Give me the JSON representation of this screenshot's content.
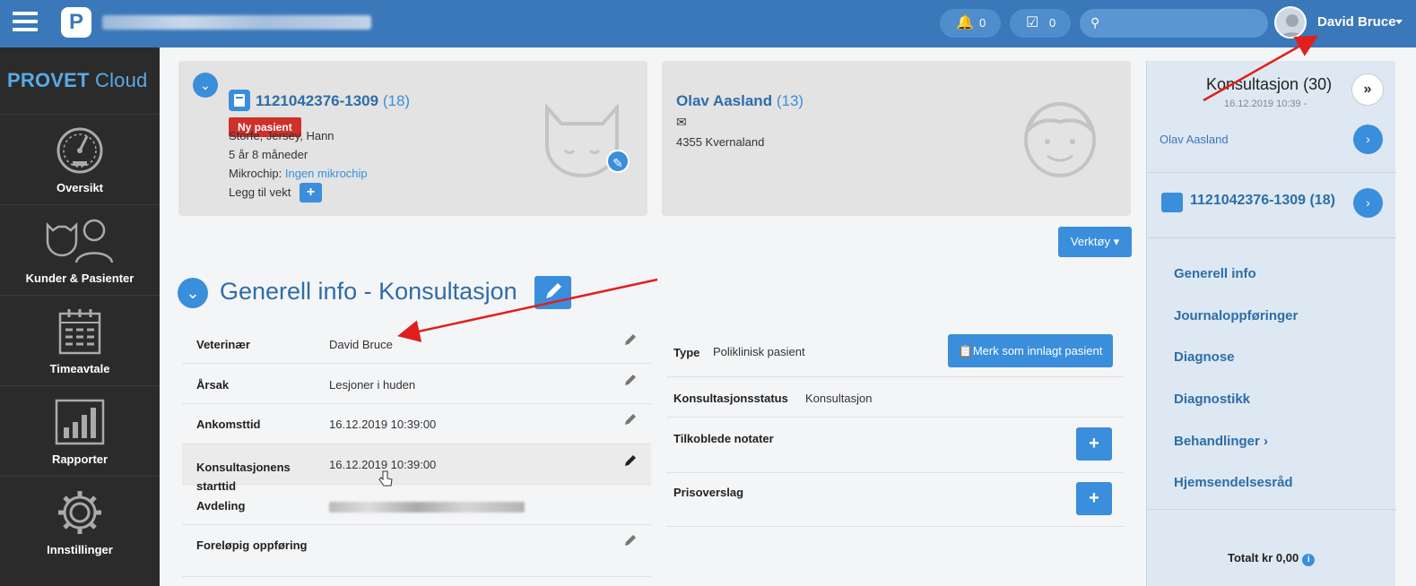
{
  "topbar": {
    "notifications_count": "0",
    "tasks_count": "0",
    "search_placeholder": "",
    "user_name": "David Bruce"
  },
  "sidebar": {
    "brand_part1": "PROVET",
    "brand_part2": "Cloud",
    "items": [
      {
        "label": "Oversikt",
        "icon": "dashboard-gauge-icon"
      },
      {
        "label": "Kunder & Pasienter",
        "icon": "customers-patients-icon"
      },
      {
        "label": "Timeavtale",
        "icon": "calendar-icon"
      },
      {
        "label": "Rapporter",
        "icon": "bar-chart-icon"
      },
      {
        "label": "Innstillinger",
        "icon": "gear-icon"
      }
    ]
  },
  "patient": {
    "id": "1121042376-1309",
    "count": "(18)",
    "badge": "Ny pasient",
    "species": "Storfe, Jersey, Hann",
    "age": "5 år 8 måneder",
    "microchip_label": "Mikrochip:",
    "microchip_value": "Ingen mikrochip",
    "add_weight": "Legg til vekt"
  },
  "owner": {
    "name": "Olav Aasland",
    "count": "(13)",
    "address": "4355 Kvernaland"
  },
  "tools_button": "Verktøy",
  "section": {
    "title": "Generell info - Konsultasjon"
  },
  "left_rows": [
    {
      "label": "Veterinær",
      "value": "David Bruce"
    },
    {
      "label": "Årsak",
      "value": "Lesjoner i huden"
    },
    {
      "label": "Ankomsttid",
      "value": "16.12.2019 10:39:00"
    },
    {
      "label": "Konsultasjonens starttid",
      "value": "16.12.2019 10:39:00"
    },
    {
      "label": "Avdeling",
      "value": ""
    },
    {
      "label": "Foreløpig oppføring",
      "value": ""
    }
  ],
  "right_rows": {
    "type_label": "Type",
    "type_value": "Poliklinisk pasient",
    "admit_button": "Merk som innlagt pasient",
    "status_label": "Konsultasjonsstatus",
    "status_value": "Konsultasjon",
    "notes_label": "Tilkoblede notater",
    "estimate_label": "Prisoverslag"
  },
  "right_panel": {
    "title": "Konsultasjon (30)",
    "date": "16.12.2019 10:39 -",
    "owner": "Olav Aasland",
    "patient_id": "1121042376-1309 (18)",
    "links": [
      "Generell info",
      "Journaloppføringer",
      "Diagnose",
      "Diagnostikk",
      "Behandlinger",
      "Hjemsendelsesråd"
    ],
    "total": "Totalt kr 0,00"
  },
  "colors": {
    "topbar": "#3a78ba",
    "sidebar": "#2b2b2b",
    "accent": "#3a8edb",
    "badge_red": "#d0302a",
    "annotation_arrow": "#e0201c"
  }
}
